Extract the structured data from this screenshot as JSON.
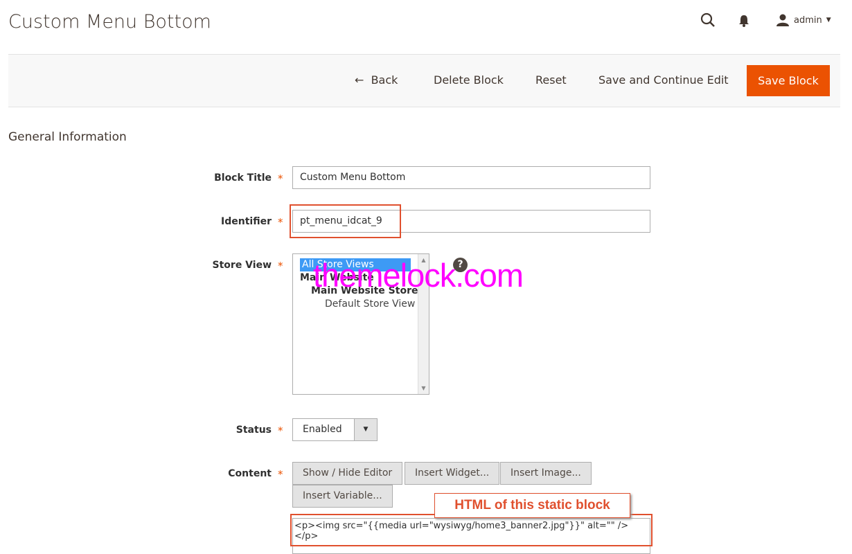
{
  "header": {
    "title": "Custom Menu Bottom",
    "user": "admin",
    "icons": [
      "search-icon",
      "bell-icon",
      "user-icon"
    ]
  },
  "toolbar": {
    "back": "Back",
    "delete": "Delete Block",
    "reset": "Reset",
    "save_continue": "Save and Continue Edit",
    "save": "Save Block"
  },
  "section_title": "General Information",
  "form": {
    "block_title_label": "Block Title",
    "block_title_value": "Custom Menu Bottom",
    "identifier_label": "Identifier",
    "identifier_value": "pt_menu_idcat_9",
    "store_view_label": "Store View",
    "store_options": [
      "All Store Views",
      "Main Website",
      "Main Website Store",
      "Default Store View"
    ],
    "store_selected": "All Store Views",
    "status_label": "Status",
    "status_value": "Enabled",
    "content_label": "Content",
    "buttons": [
      "Show / Hide Editor",
      "Insert Widget...",
      "Insert Image...",
      "Insert Variable..."
    ],
    "content_value": "<p><img src=\"{{media url=\"wysiwyg/home3_banner2.jpg\"}}\" alt=\"\" /></p>",
    "required": "*"
  },
  "annotation": "HTML of this static block",
  "watermark": "themelock.com",
  "colors": {
    "accent": "#eb5202",
    "annotation": "#e0502e",
    "watermark": "#ff00ff",
    "selected": "#3d9af5"
  }
}
